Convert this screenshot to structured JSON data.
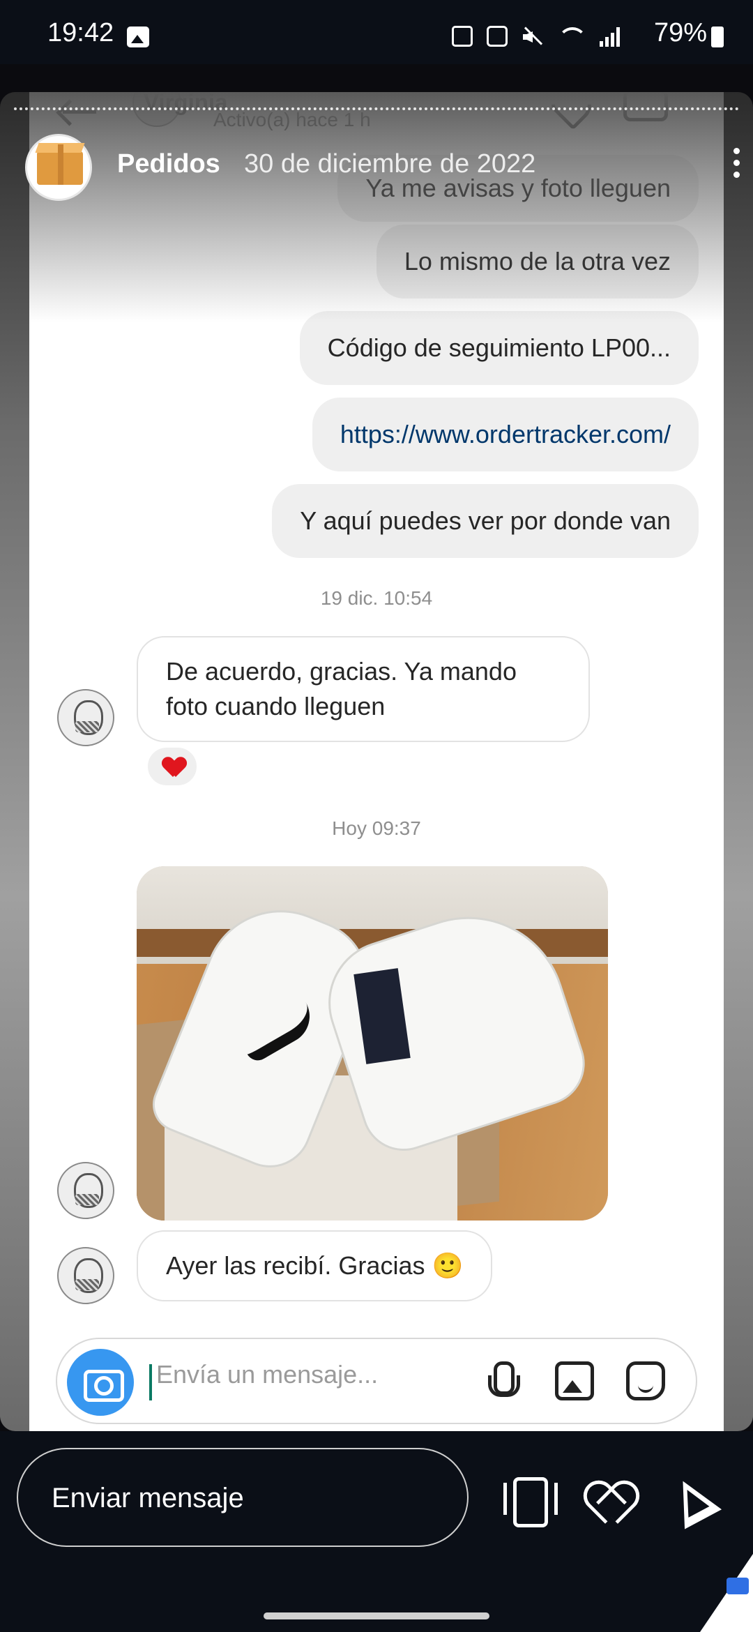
{
  "status_bar": {
    "time": "19:42",
    "battery": "79%",
    "icons": [
      "gallery-icon",
      "upload-icon",
      "nfc-icon",
      "mute-icon",
      "wifi-icon",
      "signal-icon",
      "battery-icon"
    ]
  },
  "story": {
    "title": "Pedidos",
    "date": "30 de diciembre de 2022"
  },
  "chat": {
    "contact_name": "Virginia",
    "contact_status": "Activo(a) hace 1 h",
    "messages": [
      {
        "type": "outgoing",
        "text": "Ya me avisas y foto lleguen"
      },
      {
        "type": "outgoing",
        "text": "Lo mismo de la otra vez"
      },
      {
        "type": "outgoing",
        "text": "Código de seguimiento LP00..."
      },
      {
        "type": "outgoing",
        "text": "https://www.ordertracker.com/"
      },
      {
        "type": "outgoing",
        "text": "Y aquí puedes ver por donde van"
      },
      {
        "type": "timestamp",
        "text": "19 dic. 10:54"
      },
      {
        "type": "incoming",
        "text": "De acuerdo, gracias. Ya mando\nfoto cuando lleguen",
        "reaction": "❤"
      },
      {
        "type": "timestamp",
        "text": "Hoy 09:37"
      },
      {
        "type": "incoming-photo",
        "content": "sneakers-photo"
      },
      {
        "type": "incoming",
        "text": "Ayer las recibí. Gracias 🙂"
      }
    ],
    "composer_placeholder": "Envía un mensaje..."
  },
  "reply_bar": {
    "placeholder": "Enviar mensaje"
  },
  "colors": {
    "accent_blue": "#3797f0",
    "heart_red": "#e0161e",
    "link": "#00376b"
  }
}
